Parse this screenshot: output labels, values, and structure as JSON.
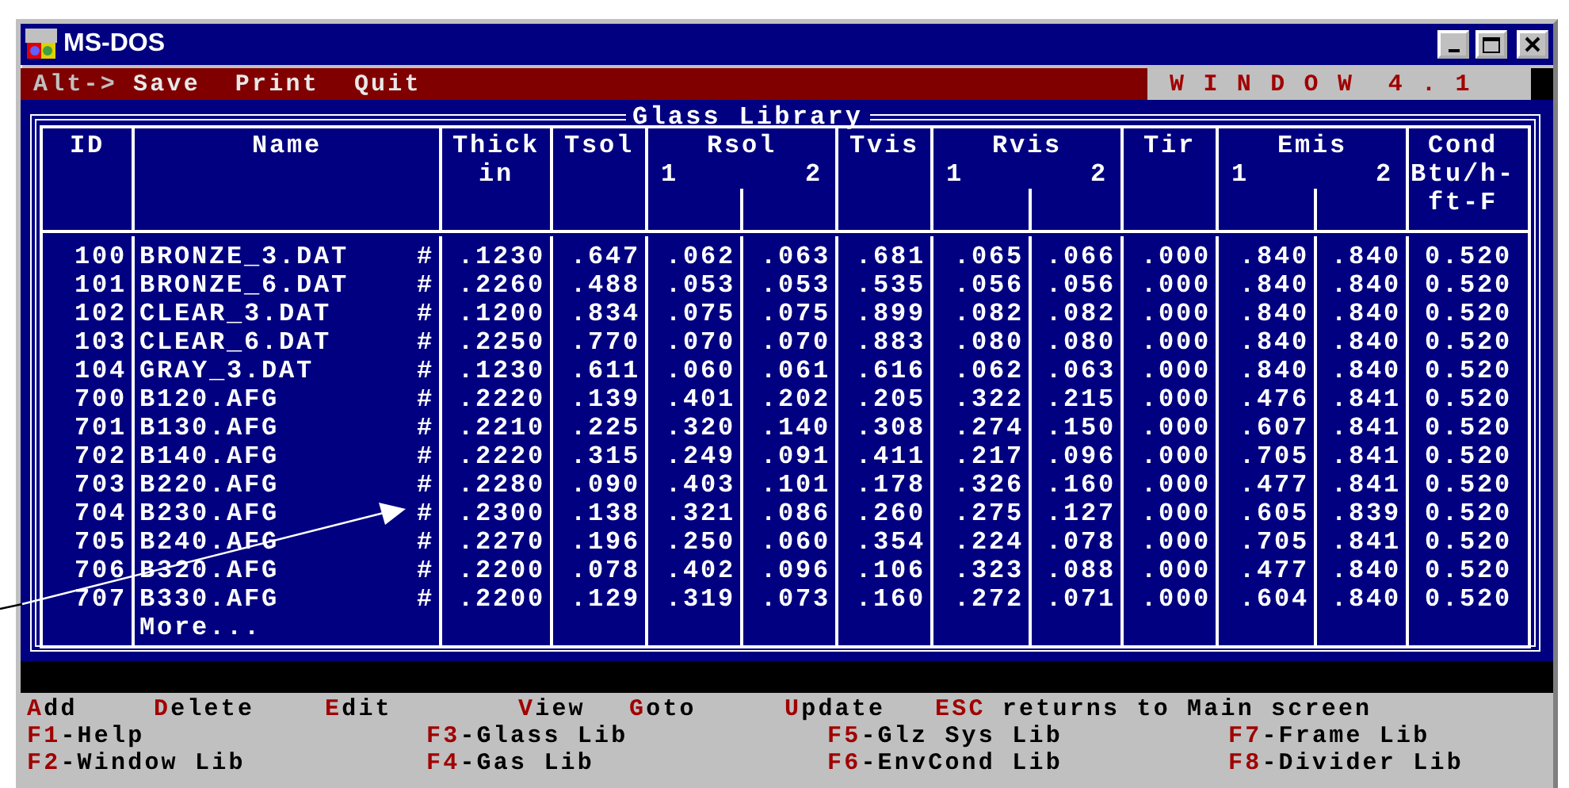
{
  "window": {
    "title": "MS-DOS"
  },
  "menu": {
    "prefix": "Alt->",
    "items": [
      "Save",
      "Print",
      "Quit"
    ],
    "product": "W I N D O W  4 . 1"
  },
  "table": {
    "title": "Glass Library",
    "columns": [
      {
        "kind": "single",
        "lines": [
          "ID"
        ]
      },
      {
        "kind": "single",
        "lines": [
          "Name"
        ]
      },
      {
        "kind": "single",
        "lines": [
          "Thick",
          "in"
        ]
      },
      {
        "kind": "single",
        "lines": [
          "Tsol"
        ]
      },
      {
        "kind": "pair",
        "title": "Rsol",
        "subs": [
          "1",
          "2"
        ]
      },
      {
        "kind": "single",
        "lines": [
          "Tvis"
        ]
      },
      {
        "kind": "pair",
        "title": "Rvis",
        "subs": [
          "1",
          "2"
        ]
      },
      {
        "kind": "single",
        "lines": [
          "Tir"
        ]
      },
      {
        "kind": "pair",
        "title": "Emis",
        "subs": [
          "1",
          "2"
        ]
      },
      {
        "kind": "single",
        "lines": [
          "Cond",
          "Btu/h-",
          "ft-F"
        ]
      }
    ],
    "rows": [
      {
        "id": "100",
        "name": "BRONZE_3.DAT",
        "mark": "#",
        "values": [
          ".1230",
          ".647",
          ".062",
          ".063",
          ".681",
          ".065",
          ".066",
          ".000",
          ".840",
          ".840",
          "0.520"
        ]
      },
      {
        "id": "101",
        "name": "BRONZE_6.DAT",
        "mark": "#",
        "values": [
          ".2260",
          ".488",
          ".053",
          ".053",
          ".535",
          ".056",
          ".056",
          ".000",
          ".840",
          ".840",
          "0.520"
        ]
      },
      {
        "id": "102",
        "name": "CLEAR_3.DAT",
        "mark": "#",
        "values": [
          ".1200",
          ".834",
          ".075",
          ".075",
          ".899",
          ".082",
          ".082",
          ".000",
          ".840",
          ".840",
          "0.520"
        ]
      },
      {
        "id": "103",
        "name": "CLEAR_6.DAT",
        "mark": "#",
        "values": [
          ".2250",
          ".770",
          ".070",
          ".070",
          ".883",
          ".080",
          ".080",
          ".000",
          ".840",
          ".840",
          "0.520"
        ]
      },
      {
        "id": "104",
        "name": "GRAY_3.DAT",
        "mark": "#",
        "values": [
          ".1230",
          ".611",
          ".060",
          ".061",
          ".616",
          ".062",
          ".063",
          ".000",
          ".840",
          ".840",
          "0.520"
        ]
      },
      {
        "id": "700",
        "name": "B120.AFG",
        "mark": "#",
        "values": [
          ".2220",
          ".139",
          ".401",
          ".202",
          ".205",
          ".322",
          ".215",
          ".000",
          ".476",
          ".841",
          "0.520"
        ]
      },
      {
        "id": "701",
        "name": "B130.AFG",
        "mark": "#",
        "values": [
          ".2210",
          ".225",
          ".320",
          ".140",
          ".308",
          ".274",
          ".150",
          ".000",
          ".607",
          ".841",
          "0.520"
        ]
      },
      {
        "id": "702",
        "name": "B140.AFG",
        "mark": "#",
        "values": [
          ".2220",
          ".315",
          ".249",
          ".091",
          ".411",
          ".217",
          ".096",
          ".000",
          ".705",
          ".841",
          "0.520"
        ]
      },
      {
        "id": "703",
        "name": "B220.AFG",
        "mark": "#",
        "values": [
          ".2280",
          ".090",
          ".403",
          ".101",
          ".178",
          ".326",
          ".160",
          ".000",
          ".477",
          ".841",
          "0.520"
        ]
      },
      {
        "id": "704",
        "name": "B230.AFG",
        "mark": "#",
        "values": [
          ".2300",
          ".138",
          ".321",
          ".086",
          ".260",
          ".275",
          ".127",
          ".000",
          ".605",
          ".839",
          "0.520"
        ]
      },
      {
        "id": "705",
        "name": "B240.AFG",
        "mark": "#",
        "values": [
          ".2270",
          ".196",
          ".250",
          ".060",
          ".354",
          ".224",
          ".078",
          ".000",
          ".705",
          ".841",
          "0.520"
        ]
      },
      {
        "id": "706",
        "name": "B320.AFG",
        "mark": "#",
        "values": [
          ".2200",
          ".078",
          ".402",
          ".096",
          ".106",
          ".323",
          ".088",
          ".000",
          ".477",
          ".840",
          "0.520"
        ]
      },
      {
        "id": "707",
        "name": "B330.AFG",
        "mark": "#",
        "values": [
          ".2200",
          ".129",
          ".319",
          ".073",
          ".160",
          ".272",
          ".071",
          ".000",
          ".604",
          ".840",
          "0.520"
        ]
      }
    ],
    "more": "More..."
  },
  "command_bar": [
    {
      "hot": "A",
      "rest": "dd"
    },
    {
      "hot": "D",
      "rest": "elete"
    },
    {
      "hot": "E",
      "rest": "dit"
    },
    {
      "hot": "V",
      "rest": "iew"
    },
    {
      "hot": "G",
      "rest": "oto"
    },
    {
      "hot": "U",
      "rest": "pdate"
    },
    {
      "hot": "ESC",
      "rest": " returns to Main screen"
    }
  ],
  "function_keys": [
    {
      "hot": "F1",
      "rest": "-Help"
    },
    {
      "hot": "F3",
      "rest": "-Glass Lib"
    },
    {
      "hot": "F5",
      "rest": "-Glz Sys Lib"
    },
    {
      "hot": "F7",
      "rest": "-Frame Lib"
    },
    {
      "hot": "F2",
      "rest": "-Window Lib"
    },
    {
      "hot": "F4",
      "rest": "-Gas Lib"
    },
    {
      "hot": "F6",
      "rest": "-EnvCond Lib"
    },
    {
      "hot": "F8",
      "rest": "-Divider Lib"
    }
  ]
}
